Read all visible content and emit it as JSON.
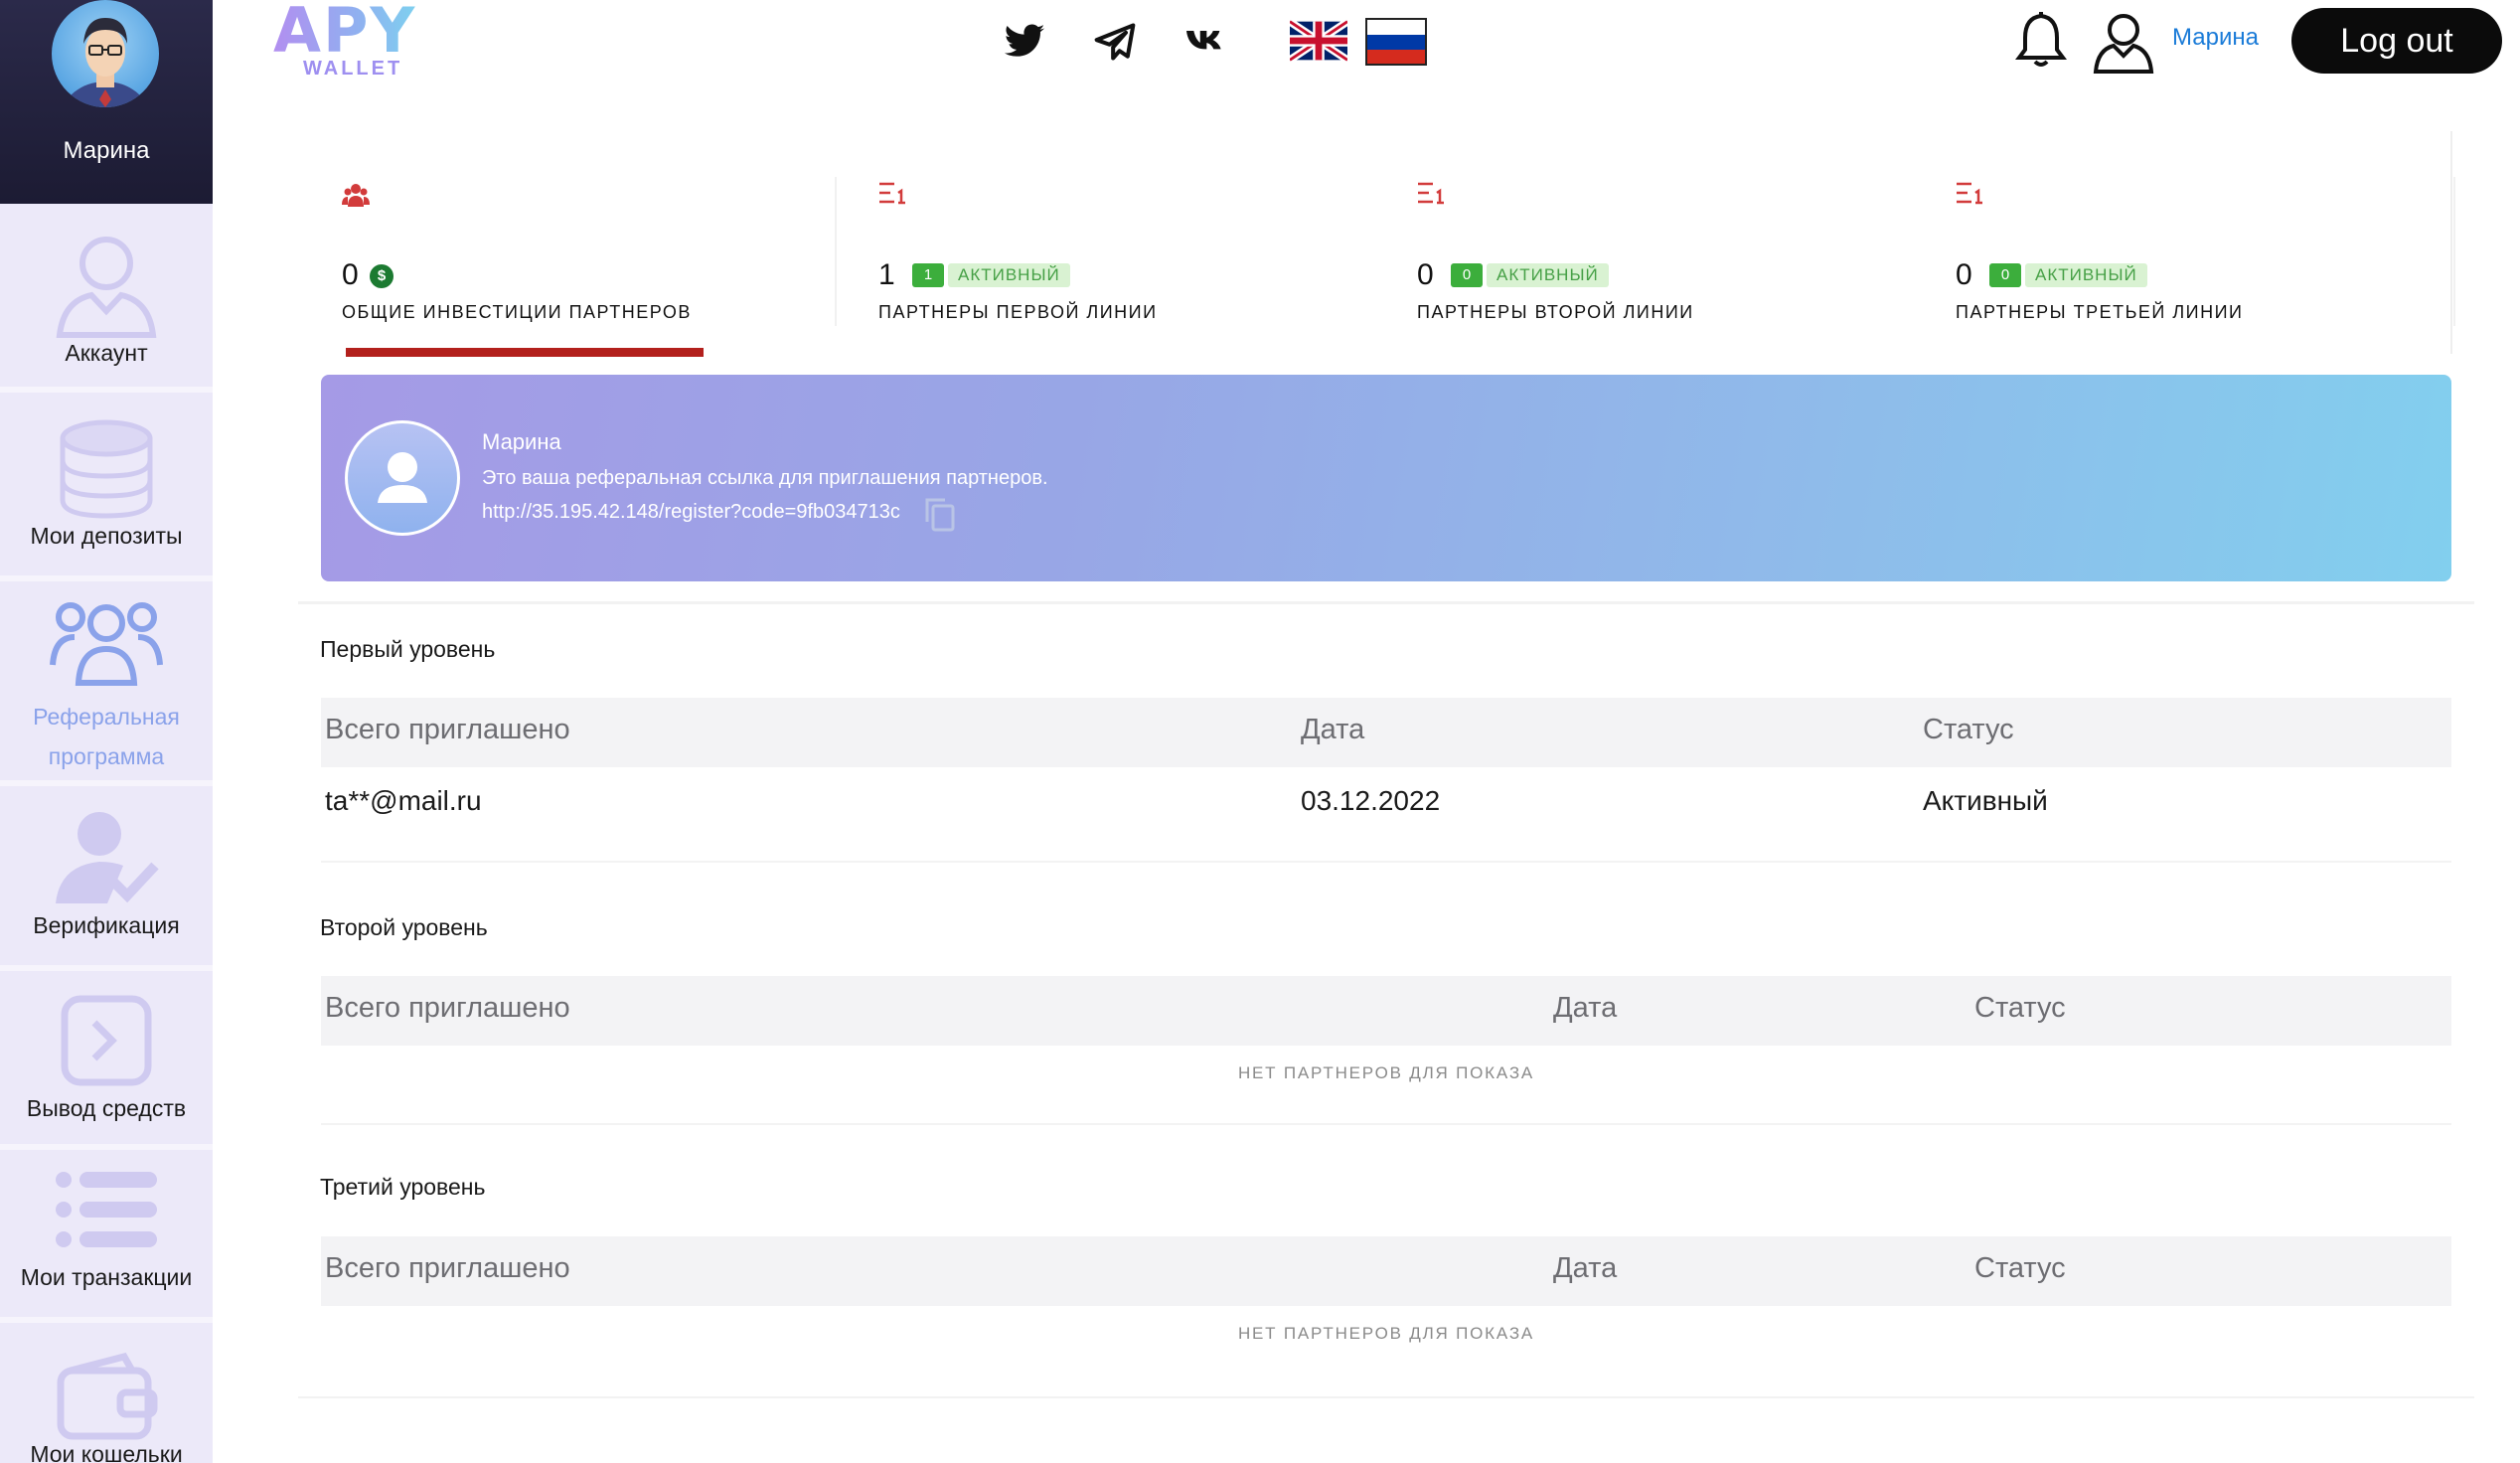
{
  "sidebar": {
    "profile_name": "Марина",
    "items": [
      {
        "label": "Аккаунт",
        "icon": "user-outline-icon"
      },
      {
        "label": "Мои депозиты",
        "icon": "coin-stack-icon"
      },
      {
        "label": "Реферальная программа",
        "icon": "group-icon"
      },
      {
        "label": "Верификация",
        "icon": "user-check-icon"
      },
      {
        "label": "Вывод средств",
        "icon": "withdraw-icon"
      },
      {
        "label": "Мои транзакции",
        "icon": "list-icon"
      },
      {
        "label": "Мои кошельки",
        "icon": "wallet-icon"
      }
    ],
    "active_color": "#8aa2ea"
  },
  "header": {
    "logo_main": "APY",
    "logo_sub": "WALLET",
    "socials": [
      "twitter-icon",
      "telegram-icon",
      "vk-icon"
    ],
    "languages": [
      "uk-flag-icon",
      "ru-flag-icon"
    ],
    "username": "Марина",
    "logout_label": "Log out"
  },
  "stats": [
    {
      "value": "0",
      "caption": "ОБЩИЕ ИНВЕСТИЦИИ ПАРТНЕРОВ",
      "currency_symbol": "$"
    },
    {
      "value": "1",
      "active_count": "1",
      "active_label": "АКТИВНЫЙ",
      "caption": "ПАРТНЕРЫ ПЕРВОЙ ЛИНИИ"
    },
    {
      "value": "0",
      "active_count": "0",
      "active_label": "АКТИВНЫЙ",
      "caption": "ПАРТНЕРЫ ВТОРОЙ ЛИНИИ"
    },
    {
      "value": "0",
      "active_count": "0",
      "active_label": "АКТИВНЫЙ",
      "caption": "ПАРТНЕРЫ ТРЕТЬЕЙ ЛИНИИ"
    }
  ],
  "banner": {
    "name": "Марина",
    "text": "Это ваша реферальная ссылка для приглашения партнеров.",
    "link": "http://35.195.42.148/register?code=9fb034713c"
  },
  "levels": [
    {
      "title": "Первый уровень",
      "columns": [
        "Всего приглашено",
        "Дата",
        "Статус"
      ],
      "rows": [
        [
          "ta**@mail.ru",
          "03.12.2022",
          "Активный"
        ]
      ],
      "empty_text": ""
    },
    {
      "title": "Второй уровень",
      "columns": [
        "Всего приглашено",
        "Дата",
        "Статус"
      ],
      "rows": [],
      "empty_text": "НЕТ ПАРТНЕРОВ ДЛЯ ПОКАЗА"
    },
    {
      "title": "Третий уровень",
      "columns": [
        "Всего приглашено",
        "Дата",
        "Статус"
      ],
      "rows": [],
      "empty_text": "НЕТ ПАРТНЕРОВ ДЛЯ ПОКАЗА"
    }
  ],
  "colors": {
    "accent_underline": "#b3201d",
    "badge_green": "#3cae3c",
    "link_blue": "#1a7bd8"
  }
}
